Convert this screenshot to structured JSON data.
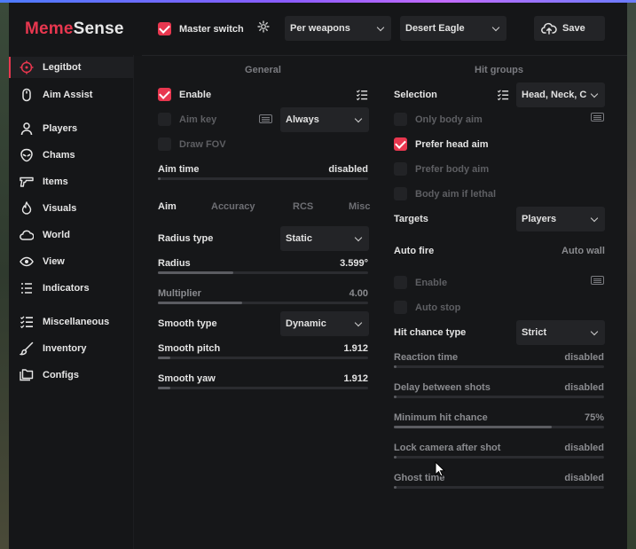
{
  "brand": {
    "part1": "Meme",
    "part2": "Sense"
  },
  "colors": {
    "accent": "#e8374f",
    "background": "#151618",
    "control": "#232427"
  },
  "header": {
    "master_switch_label": "Master switch",
    "master_switch_checked": true,
    "weapon_group": "Per weapons",
    "weapon": "Desert Eagle",
    "save_label": "Save"
  },
  "sidebar": {
    "items": [
      {
        "label": "Legitbot",
        "icon": "crosshair-icon",
        "active": true
      },
      {
        "label": "Aim Assist",
        "icon": "mouse-icon",
        "active": false
      },
      {
        "label": "Players",
        "icon": "user-icon",
        "active": false
      },
      {
        "label": "Chams",
        "icon": "alien-icon",
        "active": false
      },
      {
        "label": "Items",
        "icon": "gun-icon",
        "active": false
      },
      {
        "label": "Visuals",
        "icon": "flame-icon",
        "active": false
      },
      {
        "label": "World",
        "icon": "cloud-icon",
        "active": false
      },
      {
        "label": "View",
        "icon": "eye-icon",
        "active": false
      },
      {
        "label": "Indicators",
        "icon": "list-icon",
        "active": false
      },
      {
        "label": "Miscellaneous",
        "icon": "checklist-icon",
        "active": false
      },
      {
        "label": "Inventory",
        "icon": "brush-icon",
        "active": false
      },
      {
        "label": "Configs",
        "icon": "folders-icon",
        "active": false
      }
    ]
  },
  "general": {
    "title": "General",
    "enable_label": "Enable",
    "enable_checked": true,
    "aim_key_label": "Aim key",
    "aim_key_mode": "Always",
    "draw_fov_label": "Draw FOV",
    "aim_time_label": "Aim time",
    "aim_time_value": "disabled",
    "tabs": [
      "Aim",
      "Accuracy",
      "RCS",
      "Misc"
    ],
    "radius_type_label": "Radius type",
    "radius_type_value": "Static",
    "radius_label": "Radius",
    "radius_value": "3.599°",
    "radius_fraction": 0.36,
    "multiplier_label": "Multiplier",
    "multiplier_value": "4.00",
    "multiplier_fraction": 0.4,
    "smooth_type_label": "Smooth type",
    "smooth_type_value": "Dynamic",
    "smooth_pitch_label": "Smooth pitch",
    "smooth_pitch_value": "1.912",
    "smooth_pitch_fraction": 0.06,
    "smooth_yaw_label": "Smooth yaw",
    "smooth_yaw_value": "1.912",
    "smooth_yaw_fraction": 0.06
  },
  "hitgroups": {
    "title": "Hit groups",
    "selection_label": "Selection",
    "selection_value": "Head, Neck, C",
    "only_body_aim_label": "Only body aim",
    "prefer_head_aim_label": "Prefer head aim",
    "prefer_head_aim_checked": true,
    "prefer_body_aim_label": "Prefer body aim",
    "body_aim_if_lethal_label": "Body aim if lethal",
    "targets_label": "Targets",
    "targets_value": "Players",
    "auto_fire_label": "Auto fire",
    "auto_wall_label": "Auto wall",
    "af_enable_label": "Enable",
    "auto_stop_label": "Auto stop",
    "hit_chance_type_label": "Hit chance type",
    "hit_chance_type_value": "Strict",
    "reaction_time_label": "Reaction time",
    "reaction_time_value": "disabled",
    "delay_between_shots_label": "Delay between shots",
    "delay_between_shots_value": "disabled",
    "minimum_hit_chance_label": "Minimum hit chance",
    "minimum_hit_chance_value": "75%",
    "minimum_hit_chance_fraction": 0.75,
    "lock_camera_label": "Lock camera after shot",
    "lock_camera_value": "disabled",
    "ghost_time_label": "Ghost time",
    "ghost_time_value": "disabled"
  }
}
